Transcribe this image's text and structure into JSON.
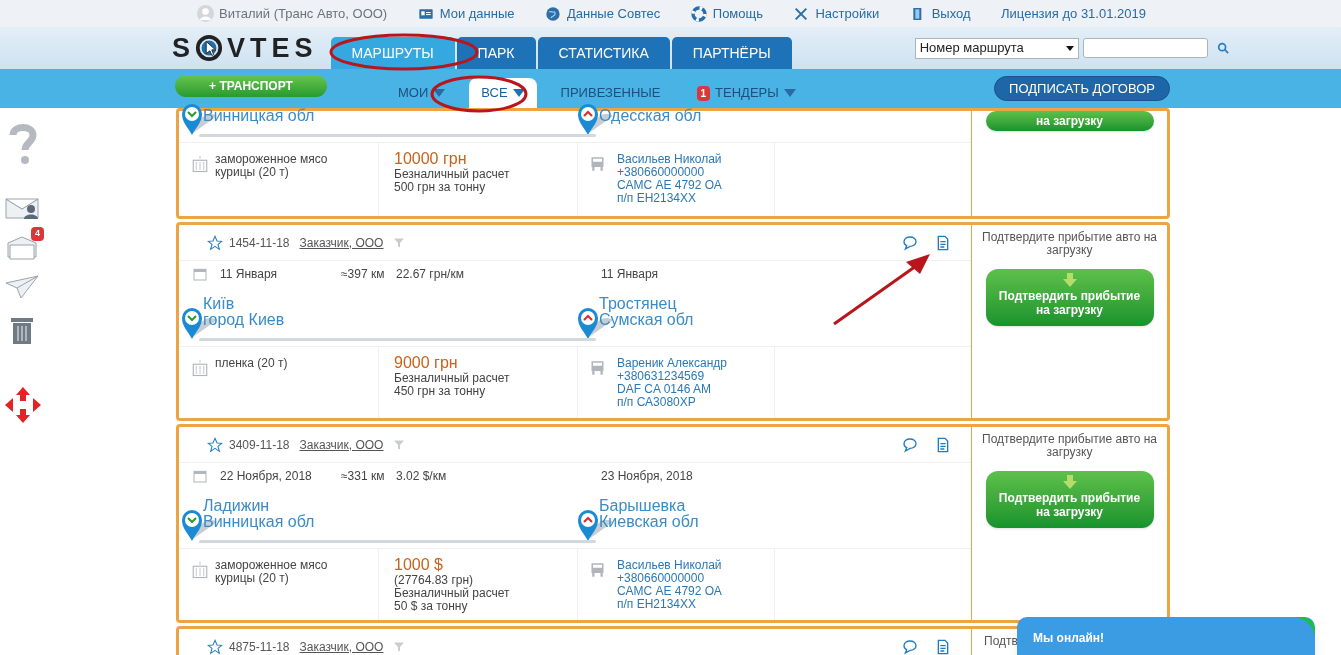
{
  "top_bar": {
    "user": "Виталий (Транс Авто, ООО)",
    "links": [
      {
        "kind": "profile",
        "label": "Мои данные"
      },
      {
        "kind": "globe",
        "label": "Данные Совтес"
      },
      {
        "kind": "help",
        "label": "Помощь"
      },
      {
        "kind": "tools",
        "label": "Настройки"
      },
      {
        "kind": "exit",
        "label": "Выход"
      }
    ],
    "license": "Лицензия до 31.01.2019"
  },
  "logo": {
    "before": "S",
    "after": "VTES"
  },
  "main_tabs": [
    {
      "label": "МАРШРУТЫ",
      "selected": true
    },
    {
      "label": "ПАРК",
      "selected": false
    },
    {
      "label": "СТАТИСТИКА",
      "selected": false
    },
    {
      "label": "ПАРТНЁРЫ",
      "selected": false
    }
  ],
  "search": {
    "select": "Номер маршрута"
  },
  "sub_bar": {
    "add_button": "+ ТРАНСПОРТ",
    "filters": [
      {
        "label": "МОИ",
        "selected": false,
        "dropdown": true
      },
      {
        "label": "ВСЕ",
        "selected": true,
        "dropdown": true
      },
      {
        "label": "ПРИВЕЗЕННЫЕ",
        "selected": false,
        "dropdown": false
      },
      {
        "label": "ТЕНДЕРЫ",
        "badge": "1",
        "selected": false,
        "dropdown": true
      }
    ],
    "sign_button": "ПОДПИСАТЬ ДОГОВОР"
  },
  "sidebar": [
    {
      "kind": "help"
    },
    {
      "kind": "inbox"
    },
    {
      "kind": "mail",
      "badge": "4"
    },
    {
      "kind": "sent"
    },
    {
      "kind": "trash"
    },
    {
      "kind": "logo"
    }
  ],
  "orders": [
    {
      "origin": {
        "region": "Винницкая обл"
      },
      "destination": {
        "region": "Одесская обл"
      },
      "cargo": "замороженное мясо курицы (20 т)",
      "price": "10000 грн",
      "payment": "Безналичный расчет",
      "per_ton": "500 грн за тонну",
      "driver": {
        "name": "Васильев Николай",
        "phone": "+380660000000",
        "truck": "САМС АЕ 4792 ОА",
        "trailer": "п/п ЕН2134ХХ"
      },
      "action_button": "на загрузку"
    },
    {
      "number": "1454-11-18",
      "customer": "Заказчик, ООО",
      "date_from": "11 Января",
      "distance": "≈397 км",
      "rate": "22.67 грн/км",
      "date_to": "11 Января",
      "origin": {
        "city": "Київ",
        "region": "город Киев"
      },
      "destination": {
        "city": "Тростянец",
        "region": "Сумская обл"
      },
      "cargo": "пленка (20 т)",
      "price": "9000 грн",
      "payment": "Безналичный расчет",
      "per_ton": "450 грн за тонну",
      "driver": {
        "name": "Вареник Александр",
        "phone": "+380631234569",
        "truck": "DAF CA 0146 AM",
        "trailer": "п/п СА3080ХР"
      },
      "status_text": "Подтвердите прибытие авто на загрузку",
      "action_button": "Подтвердить прибытие на загрузку"
    },
    {
      "number": "3409-11-18",
      "customer": "Заказчик, ООО",
      "date_from": "22 Ноября, 2018",
      "distance": "≈331 км",
      "rate": "3.02 $/км",
      "date_to": "23 Ноября, 2018",
      "origin": {
        "city": "Ладижин",
        "region": "Винницкая обл"
      },
      "destination": {
        "city": "Барышевка",
        "region": "Киевская обл"
      },
      "cargo": "замороженное мясо курицы (20 т)",
      "price": "1000 $",
      "price_alt": "(27764.83 грн)",
      "payment": "Безналичный расчет",
      "per_ton": "50 $ за тонну",
      "driver": {
        "name": "Васильев Николай",
        "phone": "+380660000000",
        "truck": "САМС АЕ 4792 ОА",
        "trailer": "п/п ЕН2134ХХ"
      },
      "status_text": "Подтвердите прибытие авто на загрузку",
      "action_button": "Подтвердить прибытие на загрузку"
    },
    {
      "number": "4875-11-18",
      "customer": "Заказчик, ООО",
      "status_text": "Подтв"
    }
  ],
  "chat": {
    "label": "Мы онлайн!"
  }
}
